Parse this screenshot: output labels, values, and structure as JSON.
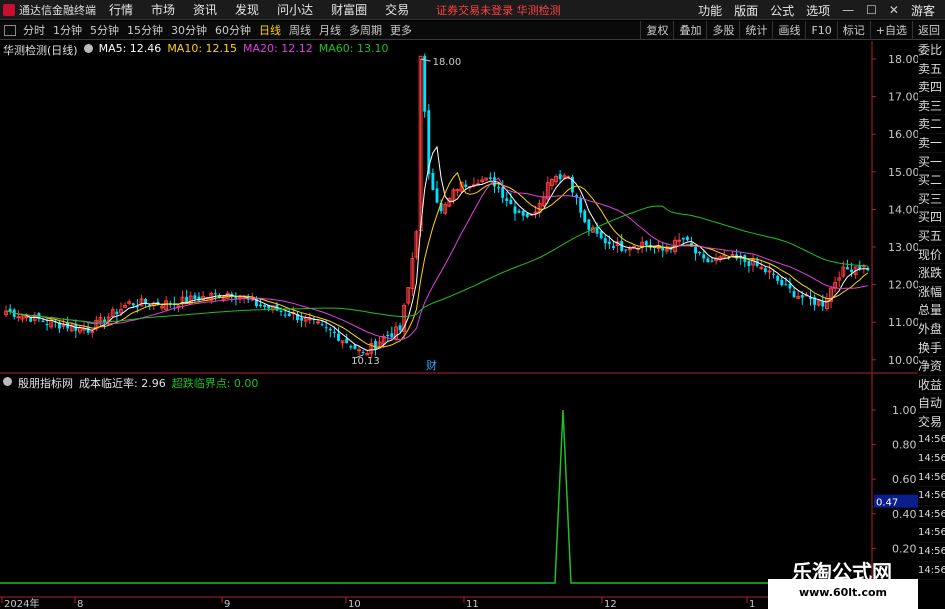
{
  "app": {
    "title": "通达信金融终端"
  },
  "menu": [
    "行情",
    "市场",
    "资讯",
    "发现",
    "问小达",
    "财富圈",
    "交易"
  ],
  "warning": "证券交易未登录  华测检测",
  "right_menu": [
    "功能",
    "版面",
    "公式",
    "选项"
  ],
  "user": "游客",
  "corner": "R 500",
  "periods": [
    "分时",
    "1分钟",
    "5分钟",
    "15分钟",
    "30分钟",
    "60分钟",
    "日线",
    "周线",
    "月线",
    "多周期",
    "更多"
  ],
  "active_period": "日线",
  "toolbar_right": [
    "复权",
    "叠加",
    "多股",
    "统计",
    "画线",
    "F10",
    "标记",
    "+自选",
    "返回"
  ],
  "stock": {
    "name": "华测检测(日线)"
  },
  "ma": {
    "ma5": {
      "label": "MA5: 12.46",
      "color": "#ffffff"
    },
    "ma10": {
      "label": "MA10: 12.15",
      "color": "#ffd400"
    },
    "ma20": {
      "label": "MA20: 12.12",
      "color": "#e040e0"
    },
    "ma60": {
      "label": "MA60: 13.10",
      "color": "#20c020"
    }
  },
  "price_axis": [
    "18.00",
    "17.00",
    "16.00",
    "15.00",
    "14.00",
    "13.00",
    "12.00",
    "11.00",
    "10.00"
  ],
  "annotations": {
    "high": "18.00",
    "low": "10.13",
    "event": "财"
  },
  "indicator": {
    "name": "殷朋指标网",
    "metric": "成本临近率: 2.96",
    "metric2": "超跌临界点: 0.00",
    "axis": [
      "1.00",
      "0.80",
      "0.60",
      "0.40",
      "0.20"
    ],
    "current": "0.47"
  },
  "x_axis": [
    "2024年",
    "8",
    "9",
    "10",
    "11",
    "12",
    "1"
  ],
  "side_panel": [
    "委比",
    "卖五",
    "卖四",
    "卖三",
    "卖二",
    "卖一",
    "买一",
    "买二",
    "买三",
    "买四",
    "买五",
    "现价",
    "涨跌",
    "涨幅",
    "总量",
    "外盘",
    "换手",
    "净资",
    "收益",
    "自动",
    "交易",
    "14:56",
    "14:56",
    "14:56",
    "14:56",
    "14:56",
    "14:56",
    "14:56",
    "14:56"
  ],
  "watermark": {
    "title": "乐淘公式网",
    "url": "www.60lt.com"
  },
  "colors": {
    "up": "#ff3c3c",
    "down": "#00e0ff",
    "signal": "#20c020",
    "axis": "#b0232a"
  }
}
